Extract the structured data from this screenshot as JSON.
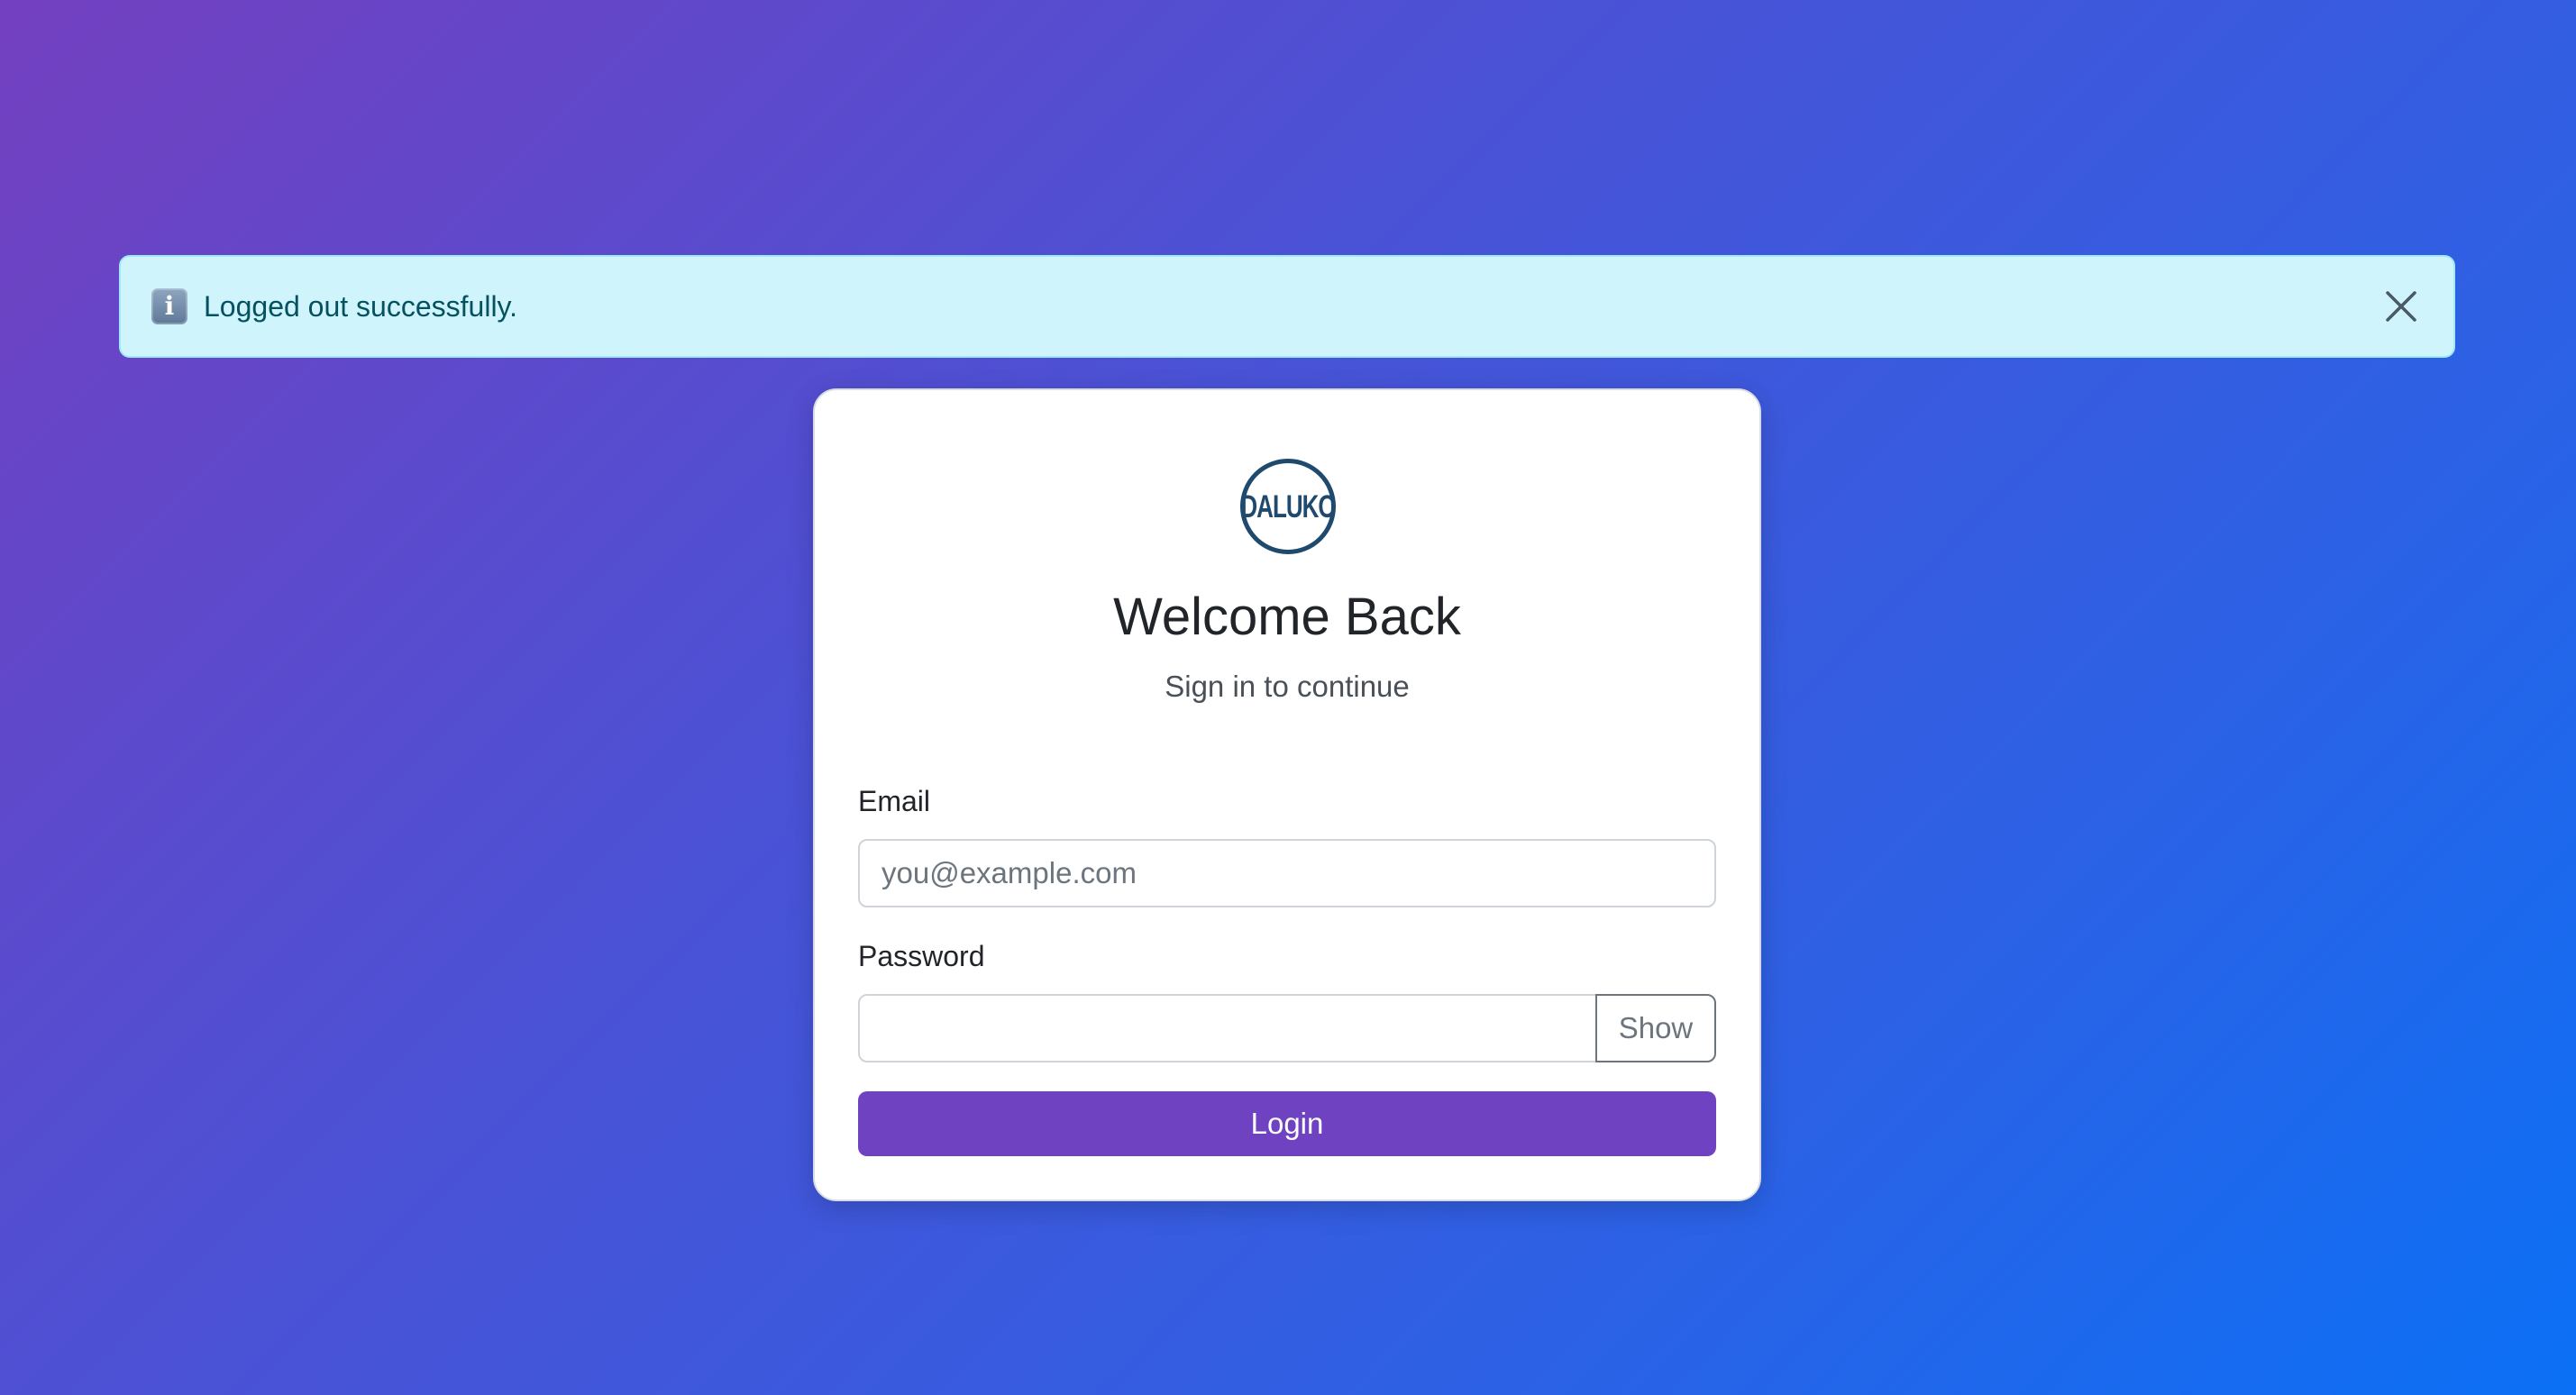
{
  "alert": {
    "icon": "info-icon",
    "icon_glyph": "i",
    "message": "Logged out successfully.",
    "close_icon": "close-icon"
  },
  "card": {
    "logo_text": "DALUKO",
    "title": "Welcome Back",
    "subtitle": "Sign in to continue"
  },
  "form": {
    "email_label": "Email",
    "email_placeholder": "you@example.com",
    "email_value": "",
    "password_label": "Password",
    "password_value": "",
    "show_label": "Show",
    "login_label": "Login"
  },
  "colors": {
    "accent": "#6f42c1",
    "alert_bg": "#cff4fc",
    "alert_text": "#055160",
    "logo": "#1f4a6e"
  }
}
